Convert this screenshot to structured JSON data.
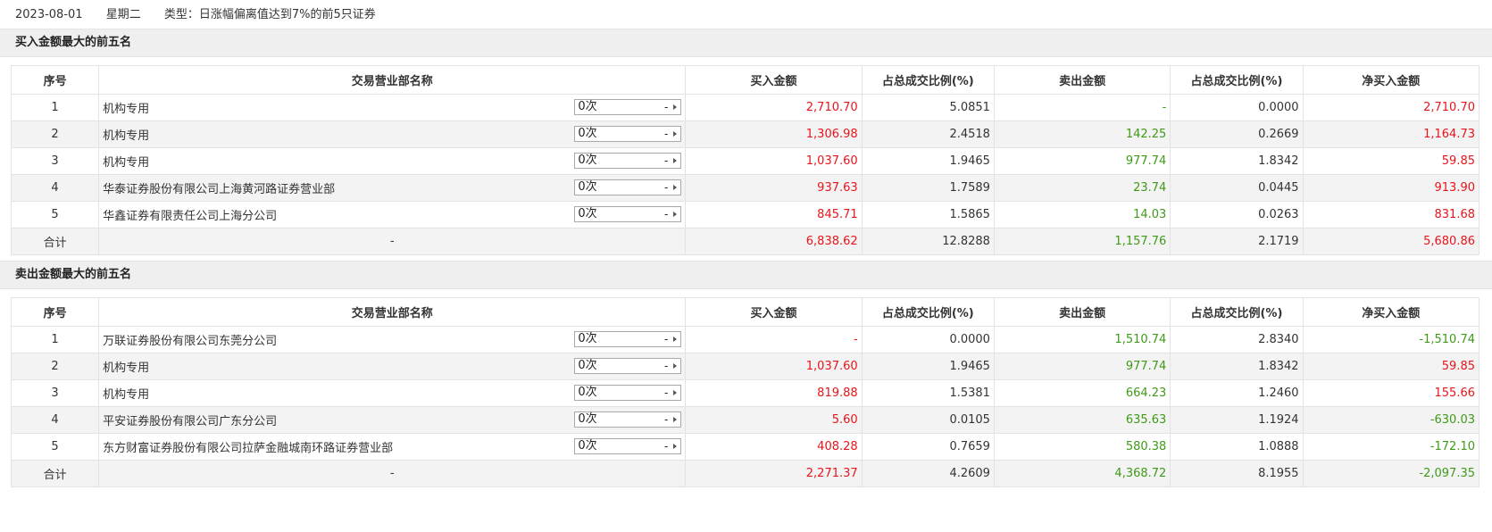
{
  "header": {
    "date": "2023-08-01",
    "weekday": "星期二",
    "type_text": "类型：日涨幅偏离值达到7%的前5只证券"
  },
  "columns": [
    "序号",
    "交易营业部名称",
    "买入金额",
    "占总成交比例(%)",
    "卖出金额",
    "占总成交比例(%)",
    "净买入金额"
  ],
  "colors": {
    "red": "#e8141b",
    "green": "#3e9a18"
  },
  "buy_section": {
    "title": "买入金额最大的前五名",
    "rows": [
      {
        "idx": "1",
        "name": "机构专用",
        "times": "0次",
        "ext": "-",
        "buy": "2,710.70",
        "buy_pct": "5.0851",
        "sell": "-",
        "sell_pct": "0.0000",
        "net": "2,710.70"
      },
      {
        "idx": "2",
        "name": "机构专用",
        "times": "0次",
        "ext": "-",
        "buy": "1,306.98",
        "buy_pct": "2.4518",
        "sell": "142.25",
        "sell_pct": "0.2669",
        "net": "1,164.73"
      },
      {
        "idx": "3",
        "name": "机构专用",
        "times": "0次",
        "ext": "-",
        "buy": "1,037.60",
        "buy_pct": "1.9465",
        "sell": "977.74",
        "sell_pct": "1.8342",
        "net": "59.85"
      },
      {
        "idx": "4",
        "name": "华泰证券股份有限公司上海黄河路证券营业部",
        "times": "0次",
        "ext": "-",
        "buy": "937.63",
        "buy_pct": "1.7589",
        "sell": "23.74",
        "sell_pct": "0.0445",
        "net": "913.90"
      },
      {
        "idx": "5",
        "name": "华鑫证券有限责任公司上海分公司",
        "times": "0次",
        "ext": "-",
        "buy": "845.71",
        "buy_pct": "1.5865",
        "sell": "14.03",
        "sell_pct": "0.0263",
        "net": "831.68"
      }
    ],
    "total": {
      "label": "合计",
      "name": "-",
      "buy": "6,838.62",
      "buy_pct": "12.8288",
      "sell": "1,157.76",
      "sell_pct": "2.1719",
      "net": "5,680.86"
    }
  },
  "sell_section": {
    "title": "卖出金额最大的前五名",
    "rows": [
      {
        "idx": "1",
        "name": "万联证券股份有限公司东莞分公司",
        "times": "0次",
        "ext": "-",
        "buy": "-",
        "buy_pct": "0.0000",
        "sell": "1,510.74",
        "sell_pct": "2.8340",
        "net": "-1,510.74"
      },
      {
        "idx": "2",
        "name": "机构专用",
        "times": "0次",
        "ext": "-",
        "buy": "1,037.60",
        "buy_pct": "1.9465",
        "sell": "977.74",
        "sell_pct": "1.8342",
        "net": "59.85"
      },
      {
        "idx": "3",
        "name": "机构专用",
        "times": "0次",
        "ext": "-",
        "buy": "819.88",
        "buy_pct": "1.5381",
        "sell": "664.23",
        "sell_pct": "1.2460",
        "net": "155.66"
      },
      {
        "idx": "4",
        "name": "平安证券股份有限公司广东分公司",
        "times": "0次",
        "ext": "-",
        "buy": "5.60",
        "buy_pct": "0.0105",
        "sell": "635.63",
        "sell_pct": "1.1924",
        "net": "-630.03"
      },
      {
        "idx": "5",
        "name": "东方财富证券股份有限公司拉萨金融城南环路证券营业部",
        "times": "0次",
        "ext": "-",
        "buy": "408.28",
        "buy_pct": "0.7659",
        "sell": "580.38",
        "sell_pct": "1.0888",
        "net": "-172.10"
      }
    ],
    "total": {
      "label": "合计",
      "name": "-",
      "buy": "2,271.37",
      "buy_pct": "4.2609",
      "sell": "4,368.72",
      "sell_pct": "8.1955",
      "net": "-2,097.35"
    }
  }
}
